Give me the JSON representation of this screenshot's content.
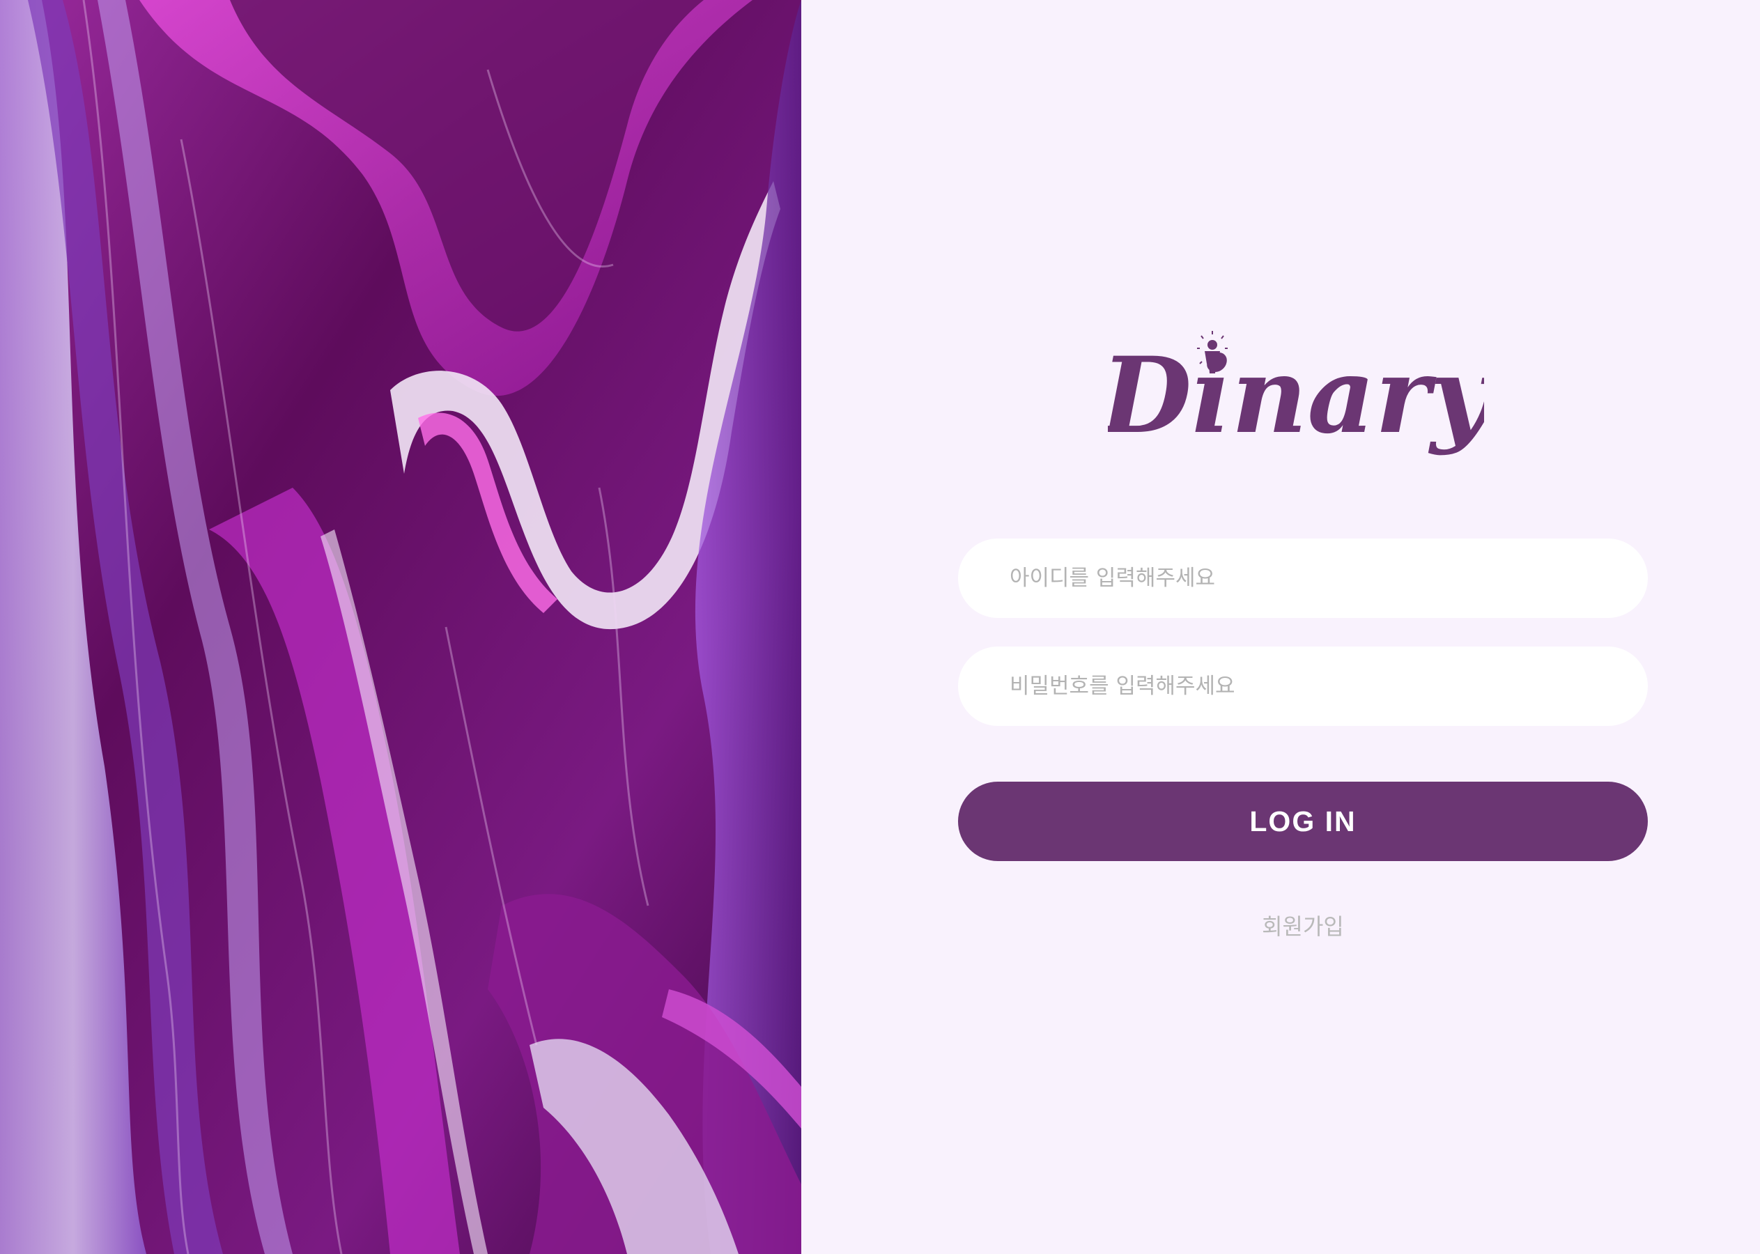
{
  "app": {
    "brand_name": "Dinary",
    "brand_color": "#6b3673",
    "background_color": "#f9f2fd"
  },
  "art_panel": {
    "image_description_icon": "purple-paint-swirl-image"
  },
  "login_form": {
    "username": {
      "value": "",
      "placeholder": "아이디를 입력해주세요"
    },
    "password": {
      "value": "",
      "placeholder": "비밀번호를 입력해주세요"
    },
    "login_button_label": "LOG IN",
    "signup_link_label": "회원가입"
  }
}
